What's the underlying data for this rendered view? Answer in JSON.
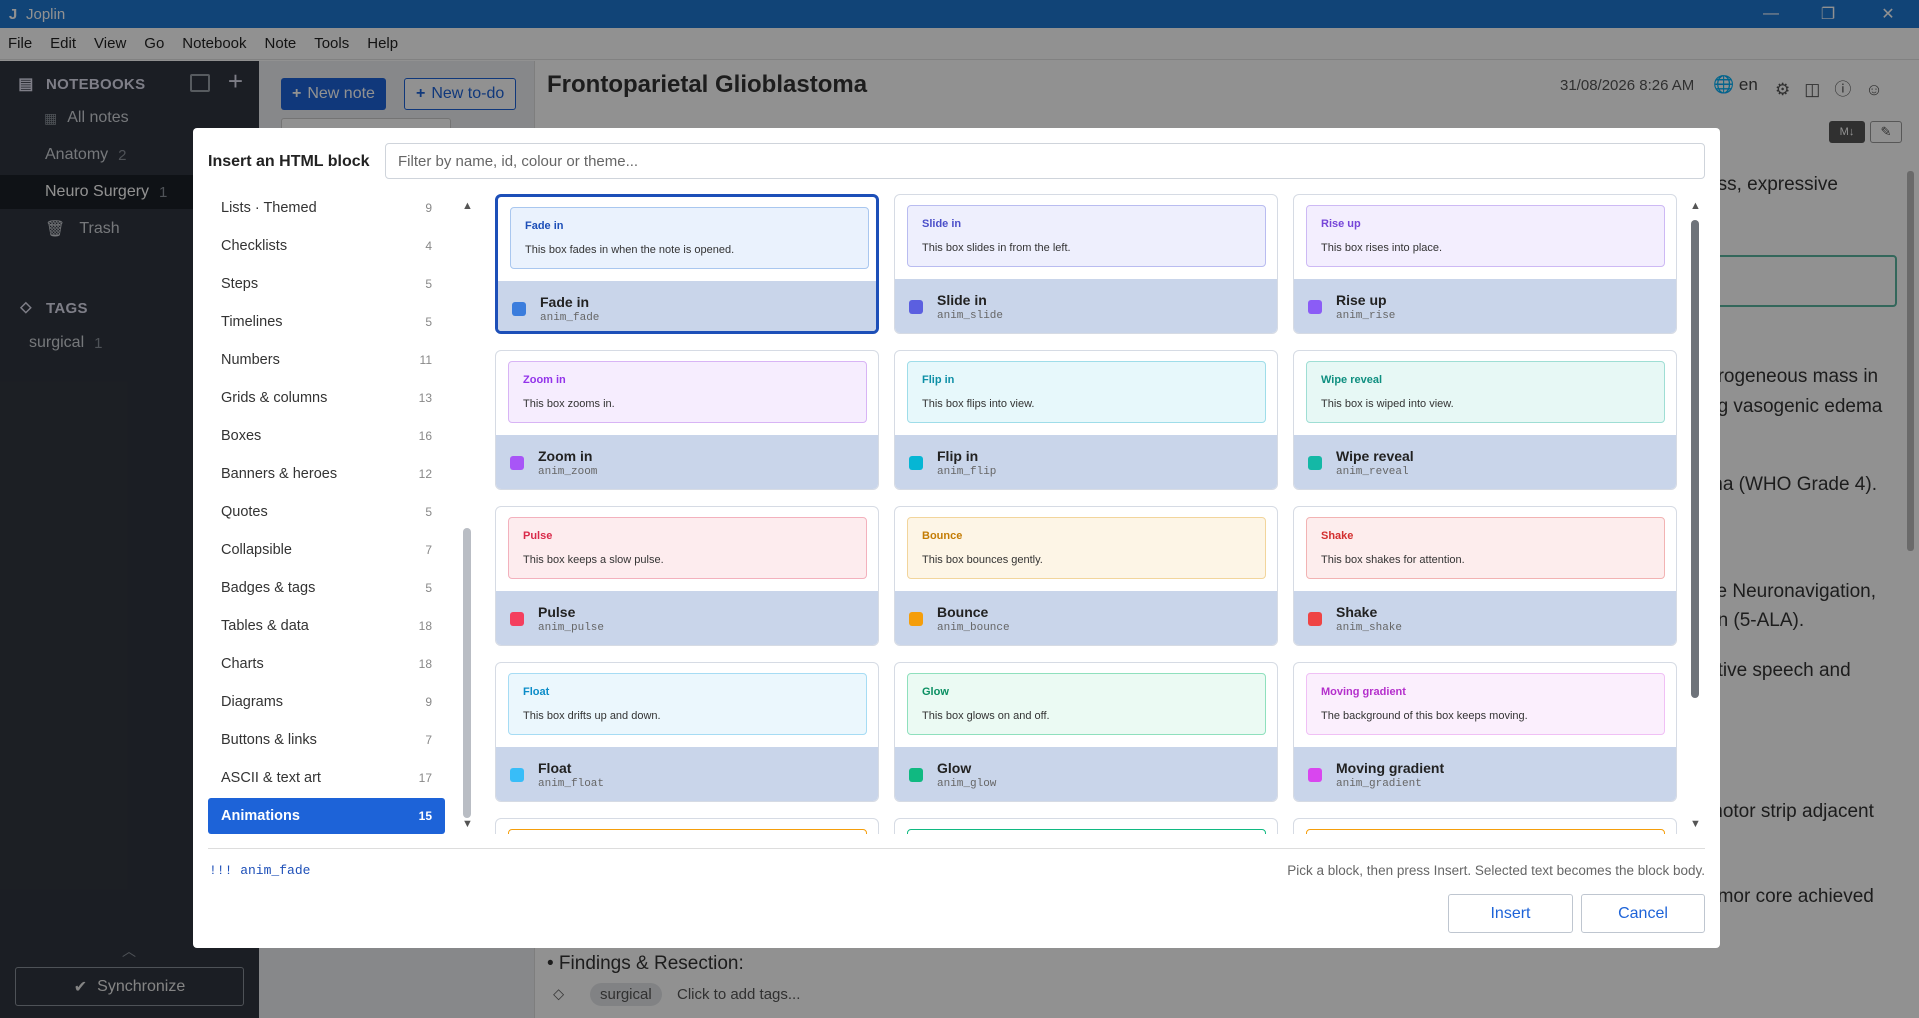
{
  "window": {
    "app_icon": "J",
    "title": "Joplin",
    "minimize": "—",
    "restore": "❐",
    "close": "✕"
  },
  "menu": [
    "File",
    "Edit",
    "View",
    "Go",
    "Notebook",
    "Note",
    "Tools",
    "Help"
  ],
  "sidebar": {
    "notebooks_label": "NOTEBOOKS",
    "notebooks": [
      {
        "label": "All notes",
        "count": ""
      },
      {
        "label": "Anatomy",
        "count": "2"
      },
      {
        "label": "Neuro Surgery",
        "count": "1"
      },
      {
        "label": "Trash",
        "count": ""
      }
    ],
    "tags_label": "TAGS",
    "tags": [
      {
        "label": "surgical",
        "count": "1"
      }
    ],
    "sync_label": "Synchronize"
  },
  "notelist": {
    "new_note": "New note",
    "new_todo": "New to-do"
  },
  "editor": {
    "title": "Frontoparietal Glioblastoma",
    "date": "31/08/2026 8:26 AM",
    "lang": "en",
    "body_fragments": [
      "ess, expressive",
      "erogeneous mass in",
      "ng vasogenic edema",
      "ma (WHO Grade 4).",
      "ve Neuronavigation,",
      "on (5-ALA).",
      "ative speech and",
      "motor strip adjacent",
      "umor core achieved"
    ],
    "section_text": "• Findings & Resection:",
    "tag": "surgical",
    "add_tags": "Click to add tags..."
  },
  "modal": {
    "title": "Insert an HTML block",
    "filter_placeholder": "Filter by name, id, colour or theme...",
    "categories": [
      {
        "label": "Lists · Themed",
        "count": "9"
      },
      {
        "label": "Checklists",
        "count": "4"
      },
      {
        "label": "Steps",
        "count": "5"
      },
      {
        "label": "Timelines",
        "count": "5"
      },
      {
        "label": "Numbers",
        "count": "11"
      },
      {
        "label": "Grids & columns",
        "count": "13"
      },
      {
        "label": "Boxes",
        "count": "16"
      },
      {
        "label": "Banners & heroes",
        "count": "12"
      },
      {
        "label": "Quotes",
        "count": "5"
      },
      {
        "label": "Collapsible",
        "count": "7"
      },
      {
        "label": "Badges & tags",
        "count": "5"
      },
      {
        "label": "Tables & data",
        "count": "18"
      },
      {
        "label": "Charts",
        "count": "18"
      },
      {
        "label": "Diagrams",
        "count": "9"
      },
      {
        "label": "Buttons & links",
        "count": "7"
      },
      {
        "label": "ASCII & text art",
        "count": "17"
      },
      {
        "label": "Animations",
        "count": "15"
      }
    ],
    "selected_category": "Animations",
    "cards": [
      {
        "name": "Fade in",
        "id": "anim_fade",
        "preview_title": "Fade in",
        "preview_text": "This box fades in when the note is opened.",
        "color": "#3b7ddd",
        "preview_bg": "#eaf2fd",
        "preview_border": "#a9c7ef",
        "title_color": "#1d4fb8"
      },
      {
        "name": "Slide in",
        "id": "anim_slide",
        "preview_title": "Slide in",
        "preview_text": "This box slides in from the left.",
        "color": "#5b5fe0",
        "preview_bg": "#eeeffd",
        "preview_border": "#b9bcf0",
        "title_color": "#4b4fc9"
      },
      {
        "name": "Rise up",
        "id": "anim_rise",
        "preview_title": "Rise up",
        "preview_text": "This box rises into place.",
        "color": "#8b5cf6",
        "preview_bg": "#f3eefe",
        "preview_border": "#cdb9f4",
        "title_color": "#7645d8"
      },
      {
        "name": "Zoom in",
        "id": "anim_zoom",
        "preview_title": "Zoom in",
        "preview_text": "This box zooms in.",
        "color": "#a855f7",
        "preview_bg": "#f6edfe",
        "preview_border": "#d8b4f5",
        "title_color": "#9333ea"
      },
      {
        "name": "Flip in",
        "id": "anim_flip",
        "preview_title": "Flip in",
        "preview_text": "This box flips into view.",
        "color": "#06b6d4",
        "preview_bg": "#e7f8fb",
        "preview_border": "#9fdde9",
        "title_color": "#0e8fa6"
      },
      {
        "name": "Wipe reveal",
        "id": "anim_reveal",
        "preview_title": "Wipe reveal",
        "preview_text": "This box is wiped into view.",
        "color": "#14b8a6",
        "preview_bg": "#e7f8f5",
        "preview_border": "#9fded4",
        "title_color": "#0f8f80"
      },
      {
        "name": "Pulse",
        "id": "anim_pulse",
        "preview_title": "Pulse",
        "preview_text": "This box keeps a slow pulse.",
        "color": "#f43f5e",
        "preview_bg": "#fdecee",
        "preview_border": "#f3b1bd",
        "title_color": "#d92a4a"
      },
      {
        "name": "Bounce",
        "id": "anim_bounce",
        "preview_title": "Bounce",
        "preview_text": "This box bounces gently.",
        "color": "#f59e0b",
        "preview_bg": "#fdf5e6",
        "preview_border": "#f2d59c",
        "title_color": "#c47d05"
      },
      {
        "name": "Shake",
        "id": "anim_shake",
        "preview_title": "Shake",
        "preview_text": "This box shakes for attention.",
        "color": "#ef4444",
        "preview_bg": "#fdeded",
        "preview_border": "#f2b3b3",
        "title_color": "#d32f2f"
      },
      {
        "name": "Float",
        "id": "anim_float",
        "preview_title": "Float",
        "preview_text": "This box drifts up and down.",
        "color": "#38bdf8",
        "preview_bg": "#ebf7fd",
        "preview_border": "#a6dcf4",
        "title_color": "#0b8cc8"
      },
      {
        "name": "Glow",
        "id": "anim_glow",
        "preview_title": "Glow",
        "preview_text": "This box glows on and off.",
        "color": "#10b981",
        "preview_bg": "#ebfaf3",
        "preview_border": "#8fe0bd",
        "title_color": "#0a8f62"
      },
      {
        "name": "Moving gradient",
        "id": "anim_gradient",
        "preview_title": "Moving gradient",
        "preview_text": "The background of this box keeps moving.",
        "color": "#d946ef",
        "preview_bg": "#fbeffd",
        "preview_border": "#f0c0f5",
        "title_color": "#b42fcc"
      }
    ],
    "code_preview": "!!! anim_fade",
    "hint": "Pick a block, then press Insert. Selected text becomes the block body.",
    "insert_label": "Insert",
    "cancel_label": "Cancel"
  }
}
